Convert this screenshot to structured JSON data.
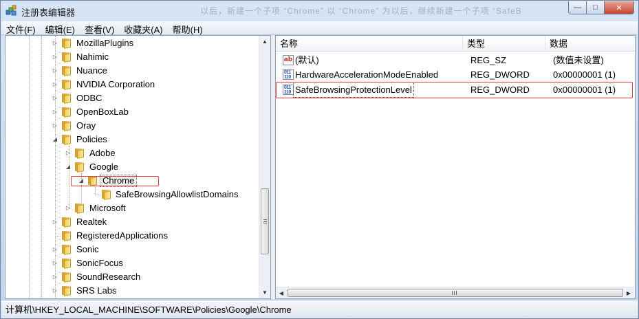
{
  "window": {
    "title": "注册表编辑器",
    "background_hint_text": "以后，新建一个子项 “Chrome” 以 “Chrome” 为以后，继续新建一个子项 “SafeB"
  },
  "menu": [
    {
      "label": "文件(F)"
    },
    {
      "label": "编辑(E)"
    },
    {
      "label": "查看(V)"
    },
    {
      "label": "收藏夹(A)"
    },
    {
      "label": "帮助(H)"
    }
  ],
  "tree": {
    "items": [
      {
        "label": "MozillaPlugins",
        "expander": "▷"
      },
      {
        "label": "Nahimic",
        "expander": "▷"
      },
      {
        "label": "Nuance",
        "expander": "▷"
      },
      {
        "label": "NVIDIA Corporation",
        "expander": "▷"
      },
      {
        "label": "ODBC",
        "expander": "▷"
      },
      {
        "label": "OpenBoxLab",
        "expander": "▷"
      },
      {
        "label": "Oray",
        "expander": "▷"
      },
      {
        "label": "Policies",
        "expander": "◢"
      },
      {
        "label": "Adobe",
        "expander": "▷"
      },
      {
        "label": "Google",
        "expander": "◢"
      },
      {
        "label": "Chrome",
        "expander": "◢"
      },
      {
        "label": "SafeBrowsingAllowlistDomains",
        "expander": ""
      },
      {
        "label": "Microsoft",
        "expander": "▷"
      },
      {
        "label": "Realtek",
        "expander": "▷"
      },
      {
        "label": "RegisteredApplications",
        "expander": ""
      },
      {
        "label": "Sonic",
        "expander": "▷"
      },
      {
        "label": "SonicFocus",
        "expander": "▷"
      },
      {
        "label": "SoundResearch",
        "expander": "▷"
      },
      {
        "label": "SRS Labs",
        "expander": "▷"
      }
    ]
  },
  "list": {
    "columns": {
      "name": "名称",
      "type": "类型",
      "data": "数据"
    },
    "rows": [
      {
        "icon": "string-value-icon",
        "icon_text": "ab",
        "name": "(默认)",
        "type": "REG_SZ",
        "data": "(数值未设置)"
      },
      {
        "icon": "dword-value-icon",
        "icon_text": "011\n110",
        "name": "HardwareAccelerationModeEnabled",
        "type": "REG_DWORD",
        "data": "0x00000001 (1)"
      },
      {
        "icon": "dword-value-icon",
        "icon_text": "011\n110",
        "name": "SafeBrowsingProtectionLevel",
        "type": "REG_DWORD",
        "data": "0x00000001 (1)"
      }
    ]
  },
  "status": {
    "path": "计算机\\HKEY_LOCAL_MACHINE\\SOFTWARE\\Policies\\Google\\Chrome"
  },
  "scroll": {
    "up": "▲",
    "down": "▼",
    "left": "◀",
    "right": "▶"
  },
  "caption": {
    "min": "—",
    "max": "□",
    "close": "✕"
  },
  "colors": {
    "highlight": "#e23a3a",
    "window_frame": "#c9d9ed"
  }
}
